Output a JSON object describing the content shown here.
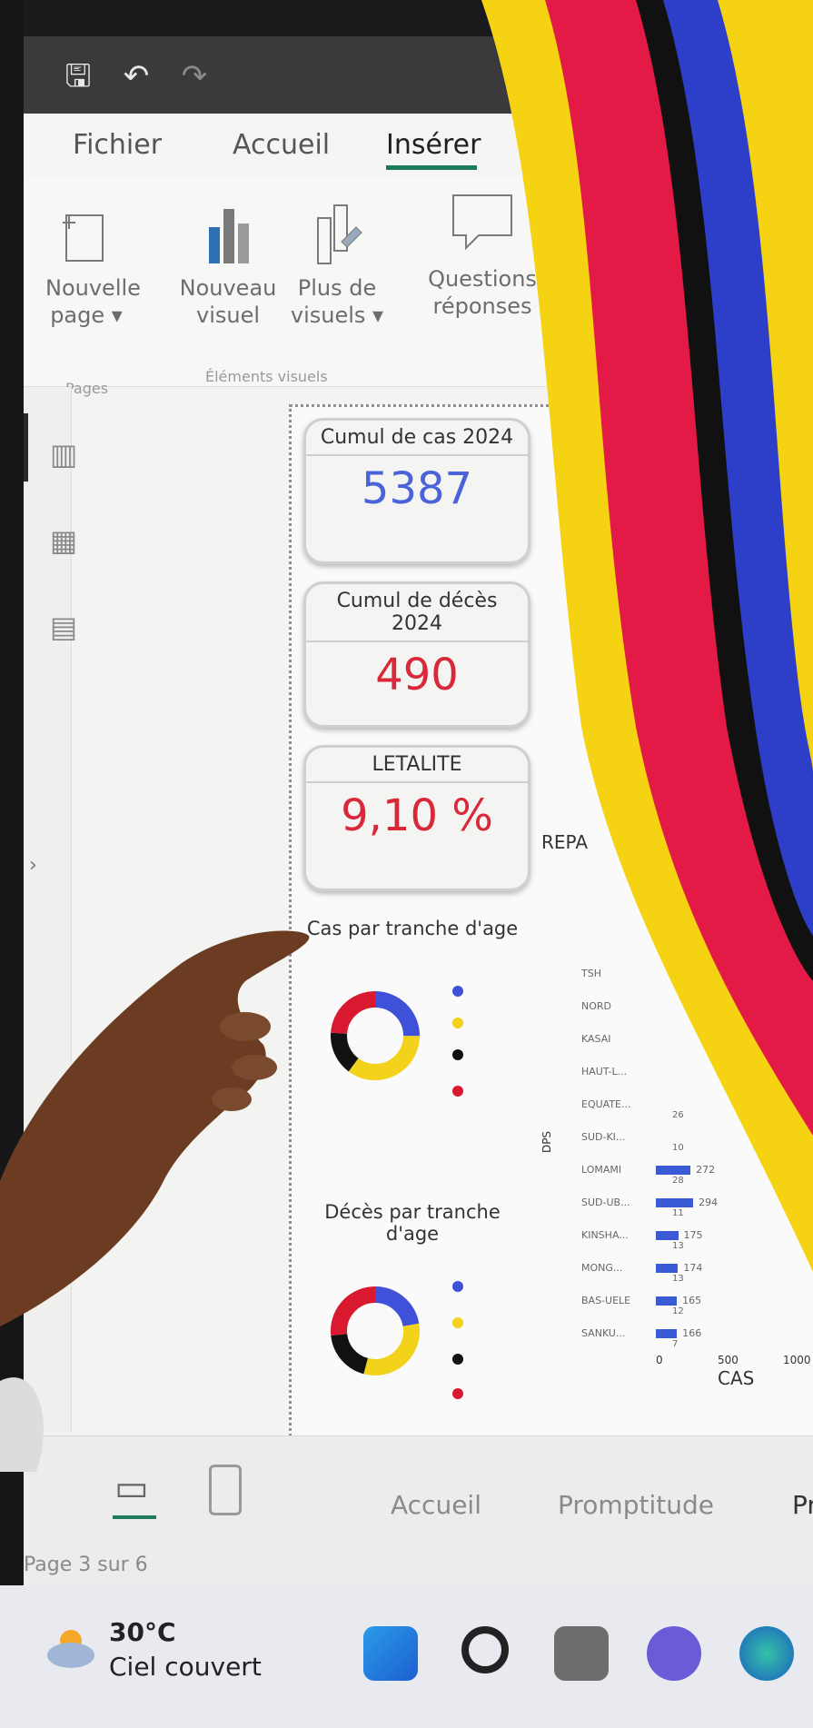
{
  "quick_access": {
    "save_icon": "save-icon",
    "undo_icon": "undo-icon",
    "redo_icon": "redo-icon"
  },
  "ribbon_tabs": [
    "Fichier",
    "Accueil",
    "Insérer"
  ],
  "ribbon": {
    "new_page": "Nouvelle\npage ▾",
    "new_visual": "Nouveau\nvisuel",
    "more_visuals": "Plus de\nvisuels ▾",
    "qa": "Questions\nréponses",
    "group_pages": "Pages",
    "group_visuals": "Éléments visuels"
  },
  "kpis": [
    {
      "title": "Cumul de cas 2024",
      "value": "5387",
      "color": "#4a63d8"
    },
    {
      "title": "Cumul de décès\n2024",
      "value": "490",
      "color": "#d8283a"
    },
    {
      "title": "LETALITE",
      "value": "9,10 %",
      "color": "#d8283a"
    }
  ],
  "repartition_label": "REPA",
  "cases_by_age_title": "Cas par tranche d'age",
  "deaths_by_age_title": "Décès par tranche\nd'age",
  "bar_chart": {
    "y_label": "DPS",
    "x_label": "CAS",
    "provinces": [
      "TSH",
      "NORD",
      "KASAI",
      "HAUT-L...",
      "EQUATE...",
      "SUD-KI...",
      "LOMAMI",
      "SUD-UB...",
      "KINSHA...",
      "MONG...",
      "BAS-UELE",
      "SANKU..."
    ],
    "values": [
      null,
      null,
      null,
      null,
      null,
      null,
      272,
      294,
      175,
      174,
      165,
      166
    ],
    "inner_values": [
      null,
      null,
      null,
      null,
      26,
      10,
      28,
      11,
      13,
      13,
      12,
      7
    ],
    "x_ticks": [
      "0",
      "500",
      "1000"
    ]
  },
  "page_tabs": [
    "Accueil",
    "Promptitude",
    "Pr"
  ],
  "page_indicator": "Page 3 sur 6",
  "weather": {
    "temp": "30°C",
    "desc": "Ciel couvert"
  },
  "colors": {
    "blue": "#3f51d8",
    "yellow": "#f2d21a",
    "black": "#111111",
    "red": "#d9192f",
    "accent_green": "#1f7a5a"
  }
}
